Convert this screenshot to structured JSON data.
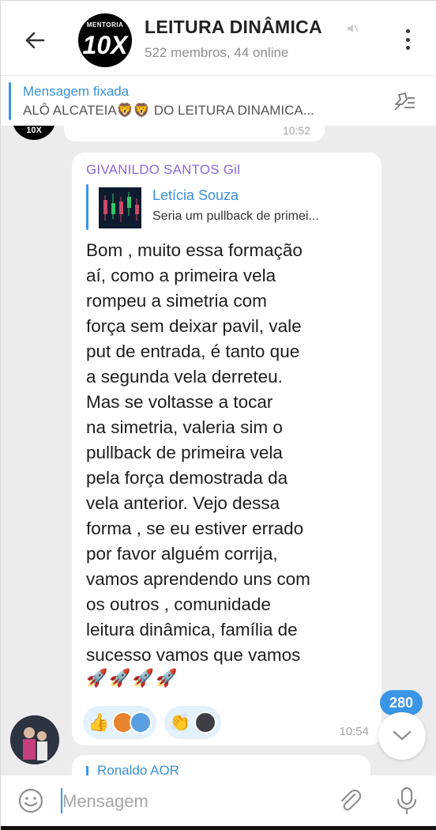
{
  "header": {
    "title": "LEITURA DINÂMICA",
    "subtitle": "522 membros, 44 online",
    "avatar_top": "MENTORIA",
    "avatar_main": "10X"
  },
  "pinned": {
    "title": "Mensagem fixada",
    "text": "ALÔ ALCATEIA🦁🦁 DO LEITURA DINAMICA..."
  },
  "previous_message": {
    "time": "10:52",
    "avatar_label": "10X"
  },
  "message": {
    "sender": "GIVANILDO SANTOS Gil",
    "reply_name": "Letícia Souza",
    "reply_text": "Seria um pullback de primei...",
    "body": "Bom , muito essa formação\naí, como a primeira vela\nrompeu a simetria com\nforça sem deixar pavil, vale\nput de entrada, é tanto que\na segunda vela derreteu.\nMas se voltasse a tocar\nna simetria, valeria sim o\npullback de primeira vela\npela força demostrada da\nvela anterior. Vejo dessa\nforma , se eu estiver errado\npor favor alguém corrija,\nvamos aprendendo uns com\nos outros , comunidade\nleitura dinâmica, família de\nsucesso vamos que vamos",
    "rockets": "🚀🚀🚀🚀",
    "reactions": [
      {
        "emoji": "👍"
      },
      {
        "emoji": "👏"
      }
    ],
    "time": "10:54"
  },
  "next_message": {
    "name": "Ronaldo AOR"
  },
  "unread_count": "280",
  "input": {
    "placeholder": "Mensagem"
  },
  "colors": {
    "accent": "#3a95e6",
    "sender": "#8a6ad8",
    "background": "#ececee"
  }
}
